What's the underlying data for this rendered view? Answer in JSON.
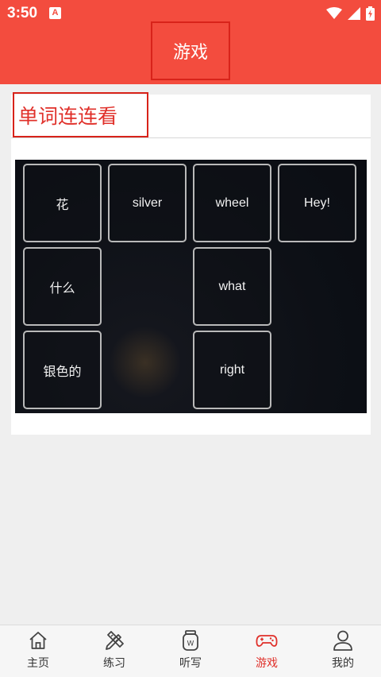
{
  "status_bar": {
    "time": "3:50",
    "notification_letter": "A"
  },
  "header": {
    "title": "游戏"
  },
  "card": {
    "title": "单词连连看"
  },
  "game": {
    "tiles": [
      {
        "text": "花",
        "row": 0,
        "col": 0
      },
      {
        "text": "silver",
        "row": 0,
        "col": 1
      },
      {
        "text": "wheel",
        "row": 0,
        "col": 2
      },
      {
        "text": "Hey!",
        "row": 0,
        "col": 3
      },
      {
        "text": "什么",
        "row": 1,
        "col": 0
      },
      {
        "text": "what",
        "row": 1,
        "col": 2
      },
      {
        "text": "银色的",
        "row": 2,
        "col": 0
      },
      {
        "text": "right",
        "row": 2,
        "col": 2
      }
    ]
  },
  "bottom_nav": {
    "items": [
      {
        "label": "主页",
        "icon": "home-icon"
      },
      {
        "label": "练习",
        "icon": "pencil-ruler-icon"
      },
      {
        "label": "听写",
        "icon": "jar-w-icon"
      },
      {
        "label": "游戏",
        "icon": "gamepad-icon",
        "active": true
      },
      {
        "label": "我的",
        "icon": "user-icon"
      }
    ]
  },
  "colors": {
    "brand_red": "#f34c3e",
    "accent_red": "#e0302a",
    "highlight_border": "#d8231a"
  }
}
